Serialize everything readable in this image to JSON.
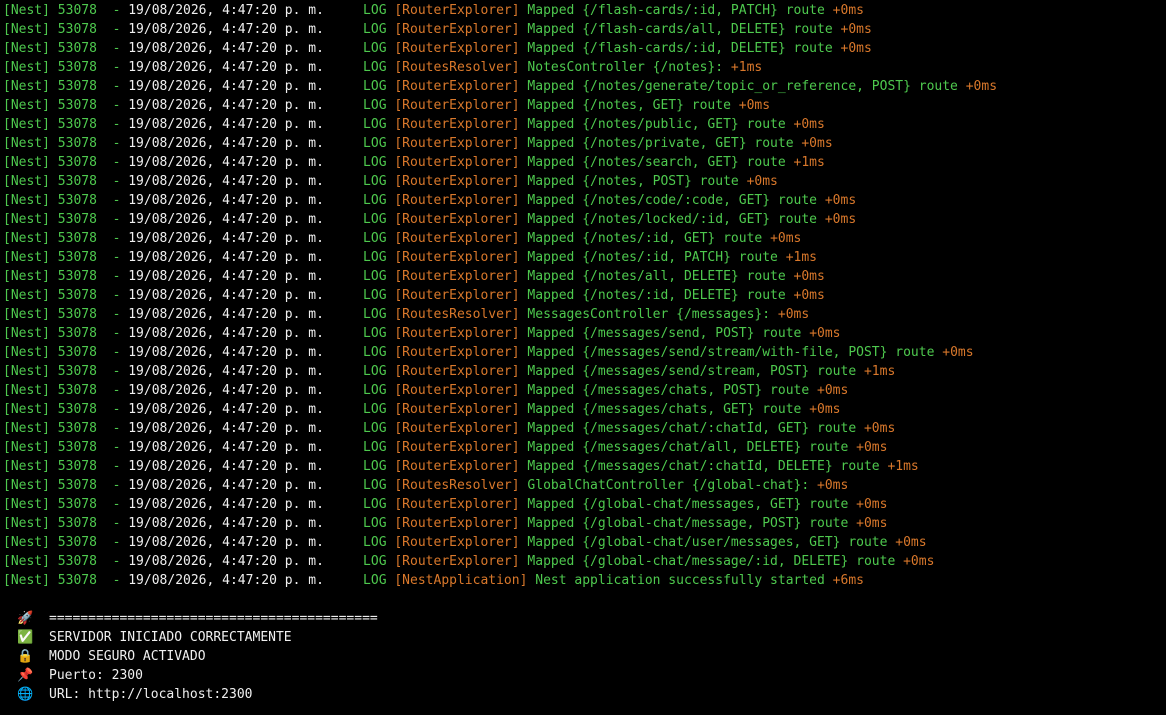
{
  "terminal": {
    "colors": {
      "background": "#000000",
      "green": "#4ec94e",
      "white": "#f0f0f0",
      "yellow": "#e5c12a",
      "orange": "#d9782b"
    },
    "log_lines": [
      {
        "prefix": "[Nest] 53078  - ",
        "timestamp": "19/08/2026, 4:47:20 p. m.",
        "level": "LOG",
        "context": "[RouterExplorer]",
        "message": "Mapped {/flash-cards/:id, PATCH} route",
        "timing": "+0ms"
      },
      {
        "prefix": "[Nest] 53078  - ",
        "timestamp": "19/08/2026, 4:47:20 p. m.",
        "level": "LOG",
        "context": "[RouterExplorer]",
        "message": "Mapped {/flash-cards/all, DELETE} route",
        "timing": "+0ms"
      },
      {
        "prefix": "[Nest] 53078  - ",
        "timestamp": "19/08/2026, 4:47:20 p. m.",
        "level": "LOG",
        "context": "[RouterExplorer]",
        "message": "Mapped {/flash-cards/:id, DELETE} route",
        "timing": "+0ms"
      },
      {
        "prefix": "[Nest] 53078  - ",
        "timestamp": "19/08/2026, 4:47:20 p. m.",
        "level": "LOG",
        "context": "[RoutesResolver]",
        "message": "NotesController {/notes}:",
        "timing": "+1ms"
      },
      {
        "prefix": "[Nest] 53078  - ",
        "timestamp": "19/08/2026, 4:47:20 p. m.",
        "level": "LOG",
        "context": "[RouterExplorer]",
        "message": "Mapped {/notes/generate/topic_or_reference, POST} route",
        "timing": "+0ms"
      },
      {
        "prefix": "[Nest] 53078  - ",
        "timestamp": "19/08/2026, 4:47:20 p. m.",
        "level": "LOG",
        "context": "[RouterExplorer]",
        "message": "Mapped {/notes, GET} route",
        "timing": "+0ms"
      },
      {
        "prefix": "[Nest] 53078  - ",
        "timestamp": "19/08/2026, 4:47:20 p. m.",
        "level": "LOG",
        "context": "[RouterExplorer]",
        "message": "Mapped {/notes/public, GET} route",
        "timing": "+0ms"
      },
      {
        "prefix": "[Nest] 53078  - ",
        "timestamp": "19/08/2026, 4:47:20 p. m.",
        "level": "LOG",
        "context": "[RouterExplorer]",
        "message": "Mapped {/notes/private, GET} route",
        "timing": "+0ms"
      },
      {
        "prefix": "[Nest] 53078  - ",
        "timestamp": "19/08/2026, 4:47:20 p. m.",
        "level": "LOG",
        "context": "[RouterExplorer]",
        "message": "Mapped {/notes/search, GET} route",
        "timing": "+1ms"
      },
      {
        "prefix": "[Nest] 53078  - ",
        "timestamp": "19/08/2026, 4:47:20 p. m.",
        "level": "LOG",
        "context": "[RouterExplorer]",
        "message": "Mapped {/notes, POST} route",
        "timing": "+0ms"
      },
      {
        "prefix": "[Nest] 53078  - ",
        "timestamp": "19/08/2026, 4:47:20 p. m.",
        "level": "LOG",
        "context": "[RouterExplorer]",
        "message": "Mapped {/notes/code/:code, GET} route",
        "timing": "+0ms"
      },
      {
        "prefix": "[Nest] 53078  - ",
        "timestamp": "19/08/2026, 4:47:20 p. m.",
        "level": "LOG",
        "context": "[RouterExplorer]",
        "message": "Mapped {/notes/locked/:id, GET} route",
        "timing": "+0ms"
      },
      {
        "prefix": "[Nest] 53078  - ",
        "timestamp": "19/08/2026, 4:47:20 p. m.",
        "level": "LOG",
        "context": "[RouterExplorer]",
        "message": "Mapped {/notes/:id, GET} route",
        "timing": "+0ms"
      },
      {
        "prefix": "[Nest] 53078  - ",
        "timestamp": "19/08/2026, 4:47:20 p. m.",
        "level": "LOG",
        "context": "[RouterExplorer]",
        "message": "Mapped {/notes/:id, PATCH} route",
        "timing": "+1ms"
      },
      {
        "prefix": "[Nest] 53078  - ",
        "timestamp": "19/08/2026, 4:47:20 p. m.",
        "level": "LOG",
        "context": "[RouterExplorer]",
        "message": "Mapped {/notes/all, DELETE} route",
        "timing": "+0ms"
      },
      {
        "prefix": "[Nest] 53078  - ",
        "timestamp": "19/08/2026, 4:47:20 p. m.",
        "level": "LOG",
        "context": "[RouterExplorer]",
        "message": "Mapped {/notes/:id, DELETE} route",
        "timing": "+0ms"
      },
      {
        "prefix": "[Nest] 53078  - ",
        "timestamp": "19/08/2026, 4:47:20 p. m.",
        "level": "LOG",
        "context": "[RoutesResolver]",
        "message": "MessagesController {/messages}:",
        "timing": "+0ms"
      },
      {
        "prefix": "[Nest] 53078  - ",
        "timestamp": "19/08/2026, 4:47:20 p. m.",
        "level": "LOG",
        "context": "[RouterExplorer]",
        "message": "Mapped {/messages/send, POST} route",
        "timing": "+0ms"
      },
      {
        "prefix": "[Nest] 53078  - ",
        "timestamp": "19/08/2026, 4:47:20 p. m.",
        "level": "LOG",
        "context": "[RouterExplorer]",
        "message": "Mapped {/messages/send/stream/with-file, POST} route",
        "timing": "+0ms"
      },
      {
        "prefix": "[Nest] 53078  - ",
        "timestamp": "19/08/2026, 4:47:20 p. m.",
        "level": "LOG",
        "context": "[RouterExplorer]",
        "message": "Mapped {/messages/send/stream, POST} route",
        "timing": "+1ms"
      },
      {
        "prefix": "[Nest] 53078  - ",
        "timestamp": "19/08/2026, 4:47:20 p. m.",
        "level": "LOG",
        "context": "[RouterExplorer]",
        "message": "Mapped {/messages/chats, POST} route",
        "timing": "+0ms"
      },
      {
        "prefix": "[Nest] 53078  - ",
        "timestamp": "19/08/2026, 4:47:20 p. m.",
        "level": "LOG",
        "context": "[RouterExplorer]",
        "message": "Mapped {/messages/chats, GET} route",
        "timing": "+0ms"
      },
      {
        "prefix": "[Nest] 53078  - ",
        "timestamp": "19/08/2026, 4:47:20 p. m.",
        "level": "LOG",
        "context": "[RouterExplorer]",
        "message": "Mapped {/messages/chat/:chatId, GET} route",
        "timing": "+0ms"
      },
      {
        "prefix": "[Nest] 53078  - ",
        "timestamp": "19/08/2026, 4:47:20 p. m.",
        "level": "LOG",
        "context": "[RouterExplorer]",
        "message": "Mapped {/messages/chat/all, DELETE} route",
        "timing": "+0ms"
      },
      {
        "prefix": "[Nest] 53078  - ",
        "timestamp": "19/08/2026, 4:47:20 p. m.",
        "level": "LOG",
        "context": "[RouterExplorer]",
        "message": "Mapped {/messages/chat/:chatId, DELETE} route",
        "timing": "+1ms"
      },
      {
        "prefix": "[Nest] 53078  - ",
        "timestamp": "19/08/2026, 4:47:20 p. m.",
        "level": "LOG",
        "context": "[RoutesResolver]",
        "message": "GlobalChatController {/global-chat}:",
        "timing": "+0ms"
      },
      {
        "prefix": "[Nest] 53078  - ",
        "timestamp": "19/08/2026, 4:47:20 p. m.",
        "level": "LOG",
        "context": "[RouterExplorer]",
        "message": "Mapped {/global-chat/messages, GET} route",
        "timing": "+0ms"
      },
      {
        "prefix": "[Nest] 53078  - ",
        "timestamp": "19/08/2026, 4:47:20 p. m.",
        "level": "LOG",
        "context": "[RouterExplorer]",
        "message": "Mapped {/global-chat/message, POST} route",
        "timing": "+0ms"
      },
      {
        "prefix": "[Nest] 53078  - ",
        "timestamp": "19/08/2026, 4:47:20 p. m.",
        "level": "LOG",
        "context": "[RouterExplorer]",
        "message": "Mapped {/global-chat/user/messages, GET} route",
        "timing": "+0ms"
      },
      {
        "prefix": "[Nest] 53078  - ",
        "timestamp": "19/08/2026, 4:47:20 p. m.",
        "level": "LOG",
        "context": "[RouterExplorer]",
        "message": "Mapped {/global-chat/message/:id, DELETE} route",
        "timing": "+0ms"
      },
      {
        "prefix": "[Nest] 53078  - ",
        "timestamp": "19/08/2026, 4:47:20 p. m.",
        "level": "LOG",
        "context": "[NestApplication]",
        "message": "Nest application successfully started",
        "timing": "+6ms"
      }
    ],
    "banner": [
      {
        "icon": "🚀",
        "icon_name": "rocket-icon",
        "text": "=========================================="
      },
      {
        "icon": "✅",
        "icon_name": "check-mark-icon",
        "text": "SERVIDOR INICIADO CORRECTAMENTE"
      },
      {
        "icon": "🔒",
        "icon_name": "lock-icon",
        "text": "MODO SEGURO ACTIVADO"
      },
      {
        "icon": "📌",
        "icon_name": "pushpin-icon",
        "text": "Puerto: 2300"
      },
      {
        "icon": "🌐",
        "icon_name": "globe-icon",
        "text": "URL: http://localhost:2300"
      }
    ]
  }
}
